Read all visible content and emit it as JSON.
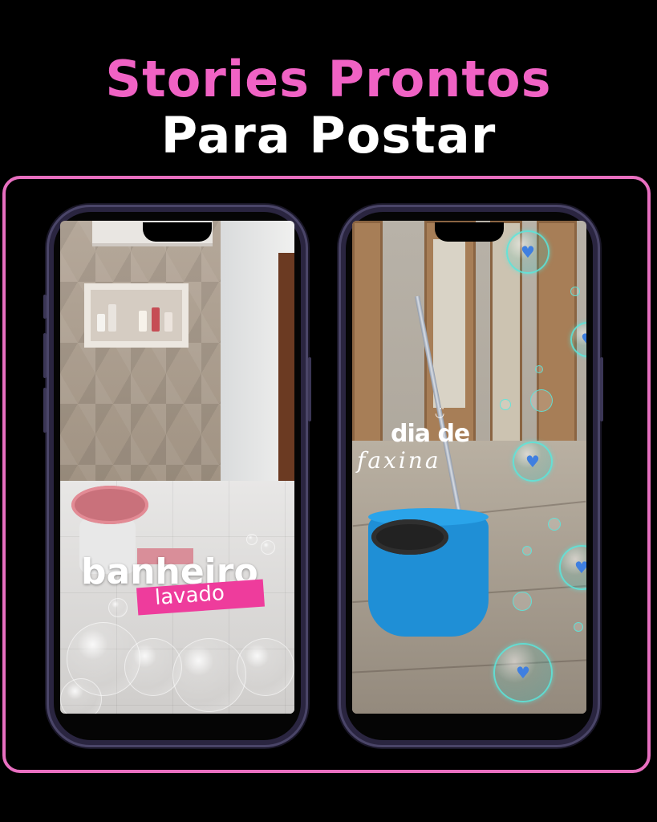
{
  "header": {
    "title_line1": "Stories Prontos",
    "title_line2": "Para Postar",
    "title_line1_color": "#f062c4",
    "title_line2_color": "#ffffff"
  },
  "accent_color": "#e86fc0",
  "phones": [
    {
      "scene": "bathroom",
      "caption_main": "banheiro",
      "caption_sub": "lavado",
      "caption_sub_bg": "#ee3c9c"
    },
    {
      "scene": "cleaning-mop-bucket",
      "caption_main": "dia de",
      "caption_script": "faxina",
      "heart_icon": "heart-icon"
    }
  ]
}
